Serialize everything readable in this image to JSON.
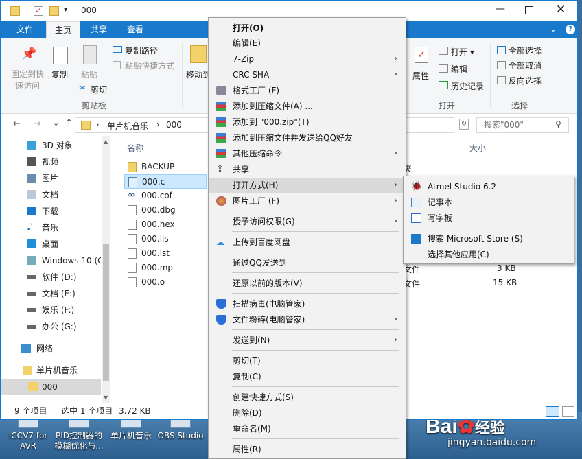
{
  "window": {
    "title": "000",
    "tabs": [
      "文件",
      "主页",
      "共享",
      "查看"
    ]
  },
  "ribbon": {
    "pin": "固定到快\n速访问",
    "copy": "复制",
    "paste": "粘贴",
    "copy_path": "复制路径",
    "paste_shortcut": "粘贴快捷方式",
    "cut": "剪切",
    "clipboard": "剪贴板",
    "move_to": "移动到",
    "properties": "属性",
    "open": "打开 ▾",
    "edit": "编辑",
    "history": "历史记录",
    "open_group": "打开",
    "select_all": "全部选择",
    "select_none": "全部取消",
    "invert": "反向选择",
    "select_group": "选择"
  },
  "address": {
    "crumb1": "单片机音乐",
    "crumb2": "000",
    "search_placeholder": "搜索\"000\""
  },
  "nav": [
    "3D 对象",
    "视频",
    "图片",
    "文档",
    "下载",
    "音乐",
    "桌面",
    "Windows 10 (C",
    "软件 (D:)",
    "文档 (E:)",
    "娱乐 (F:)",
    "办公 (G:)",
    "网络",
    "单片机音乐",
    "000"
  ],
  "files": {
    "header_name": "名称",
    "header_size": "大小",
    "items": [
      "BACKUP",
      "000.c",
      "000.cof",
      "000.dbg",
      "000.hex",
      "000.lis",
      "000.lst",
      "000.mp",
      "000.o"
    ]
  },
  "behind": {
    "type_label": "夹",
    "row1_type": "文件",
    "row1_size": "3 KB",
    "row2_type": "文件",
    "row2_size": "15 KB"
  },
  "status": {
    "count": "9 个项目",
    "selected": "选中 1 个项目",
    "size": "3.72 KB"
  },
  "context_menu": [
    "打开(O)",
    "编辑(E)",
    "7-Zip",
    "CRC SHA",
    "格式工厂 (F)",
    "添加到压缩文件(A) ...",
    "添加到 \"000.zip\"(T)",
    "添加到压缩文件并发送给QQ好友",
    "其他压缩命令",
    "共享",
    "打开方式(H)",
    "图片工厂 (F)",
    "授予访问权限(G)",
    "上传到百度网盘",
    "通过QQ发送到",
    "还原以前的版本(V)",
    "扫描病毒(电脑管家)",
    "文件粉碎(电脑管家)",
    "发送到(N)",
    "剪切(T)",
    "复制(C)",
    "创建快捷方式(S)",
    "删除(D)",
    "重命名(M)",
    "属性(R)"
  ],
  "open_with": [
    "Atmel Studio 6.2",
    "记事本",
    "写字板",
    "搜索 Microsoft Store (S)",
    "选择其他应用(C)"
  ],
  "desktop": {
    "icons": [
      "ICCV7 for\nAVR",
      "PID控制器的\n模糊优化与...",
      "单片机音乐",
      "OBS Studio"
    ],
    "watermark1": "Bai",
    "watermark2": "经验",
    "watermark3": "jingyan.baidu.com"
  },
  "colors": {
    "accent": "#1979ca",
    "highlight": "#cce8ff",
    "menu_bg": "#f2f2f2"
  }
}
